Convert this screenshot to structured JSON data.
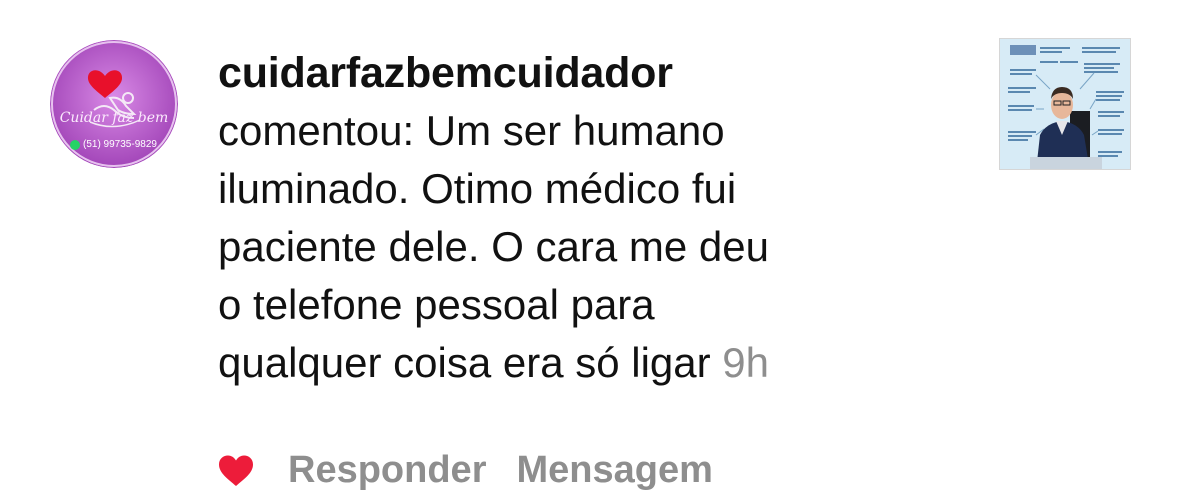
{
  "comment": {
    "username": "cuidarfazbemcuidador",
    "lines": [
      "comentou: Um ser humano",
      "iluminado. Otimo médico fui",
      "paciente dele. O cara me deu",
      "o telefone pessoal para",
      "qualquer coisa era só ligar"
    ],
    "time": "9h"
  },
  "avatar": {
    "brand_text": "Cuidar faz bem",
    "phone": "(51) 99735-9829",
    "bg_color": "#b44fc4"
  },
  "actions": {
    "like_icon": "heart-icon",
    "like_color": "#ed1c3a",
    "reply_label": "Responder",
    "message_label": "Mensagem"
  },
  "colors": {
    "text": "#111111",
    "muted": "#8e8e8e"
  }
}
